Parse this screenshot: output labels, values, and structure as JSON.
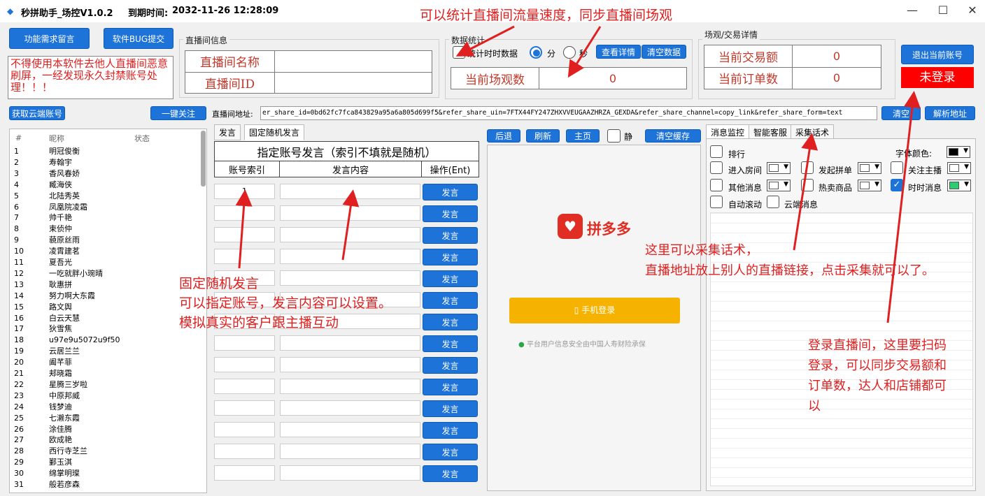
{
  "window": {
    "title": "秒拼助手_场控V1.0.2",
    "expire_label": "到期时间:",
    "expire_value": "2032-11-26 12:28:09",
    "minimize": "—",
    "maximize": "☐",
    "close": "✕"
  },
  "left_buttons": {
    "feedback": "功能需求留言",
    "bug": "软件BUG提交"
  },
  "warning_note": "不得使用本软件去他人直播间恶意刷屏，一经发现永久封禁账号处理！！！",
  "live_info": {
    "group_label": "直播间信息",
    "name_label": "直播间名称",
    "id_label": "直播间ID",
    "name_value": "",
    "id_value": ""
  },
  "stats": {
    "group_label": "数据统计",
    "realtime_checkbox": "统计时时数据",
    "unit_minute": "分",
    "unit_second": "秒",
    "detail_button": "查看详情",
    "clear_button": "清空数据",
    "viewers_label": "当前场观数",
    "viewers_value": "0"
  },
  "transaction": {
    "group_label": "场观/交易详情",
    "amount_label": "当前交易额",
    "amount_value": "0",
    "orders_label": "当前订单数",
    "orders_value": "0"
  },
  "account": {
    "logout_button": "退出当前账号",
    "status": "未登录"
  },
  "toolbar": {
    "cloud_button": "获取云端账号",
    "follow_button": "一键关注",
    "url_label": "直播间地址:",
    "url_value": "er_share_id=0bd62fc7fca843829a95a6a805d699f5&refer_share_uin=7FTX44FY247ZHXVVEUGAAZHRZA_GEXDA&refer_share_channel=copy_link&refer_share_form=text",
    "clear_button": "清空",
    "parse_button": "解析地址"
  },
  "account_list": {
    "col_num": "#",
    "col_name": "昵称",
    "col_status": "状态",
    "rows": [
      {
        "n": "1",
        "name": "明冠俊衡"
      },
      {
        "n": "2",
        "name": "寿翰宇"
      },
      {
        "n": "3",
        "name": "香风春娇"
      },
      {
        "n": "4",
        "name": "臧海侠"
      },
      {
        "n": "5",
        "name": "北陆秀英"
      },
      {
        "n": "6",
        "name": "凤凰院凌霜"
      },
      {
        "n": "7",
        "name": "帅千艳"
      },
      {
        "n": "8",
        "name": "束侦仲"
      },
      {
        "n": "9",
        "name": "藐原丝雨"
      },
      {
        "n": "10",
        "name": "凌霄建茗"
      },
      {
        "n": "11",
        "name": "夏吾光"
      },
      {
        "n": "12",
        "name": "一吃就胖小琬晴"
      },
      {
        "n": "13",
        "name": "耿惠拼"
      },
      {
        "n": "14",
        "name": "努力啊大东霞"
      },
      {
        "n": "15",
        "name": "路文舆"
      },
      {
        "n": "16",
        "name": "白云天慧"
      },
      {
        "n": "17",
        "name": "狄雪焦"
      },
      {
        "n": "18",
        "name": "u97e9u5072u9f50"
      },
      {
        "n": "19",
        "name": "云居兰兰"
      },
      {
        "n": "20",
        "name": "阖芊菲"
      },
      {
        "n": "21",
        "name": "郏晓霜"
      },
      {
        "n": "22",
        "name": "星腾三岁啦"
      },
      {
        "n": "23",
        "name": "中原邦威"
      },
      {
        "n": "24",
        "name": "钱梦迪"
      },
      {
        "n": "25",
        "name": "七濑东霞"
      },
      {
        "n": "26",
        "name": "涂佳腾"
      },
      {
        "n": "27",
        "name": "欧成艳"
      },
      {
        "n": "28",
        "name": "西行寺芝兰"
      },
      {
        "n": "29",
        "name": "鄞玉淇"
      },
      {
        "n": "30",
        "name": "绵掌明璨"
      },
      {
        "n": "31",
        "name": "般若彦森"
      }
    ]
  },
  "send_tabs": {
    "tab1": "发言",
    "tab2": "固定随机发言"
  },
  "send_table": {
    "title": "指定账号发言（索引不填就是随机）",
    "col_index": "账号索引",
    "col_content": "发言内容",
    "col_action": "操作(Ent)",
    "first_index": "1",
    "send_label": "发言"
  },
  "browser": {
    "back": "后退",
    "refresh": "刷新",
    "home": "主页",
    "mute": "静",
    "clear_cache": "清空缓存",
    "brand": "拼多多",
    "phone_login": "手机登录",
    "security_note": "平台用户信息安全由中国人寿财险承保"
  },
  "monitor": {
    "tab1": "消息监控",
    "tab2": "智能客服",
    "tab3": "采集话术",
    "rank": "排行",
    "font_color": "字体颜色:",
    "enter_room": "进入房间",
    "start_group": "发起拼单",
    "follow_host": "关注主播",
    "other_msg": "其他消息",
    "hot_goods": "热卖商品",
    "realtime_msg": "时时消息",
    "auto_scroll": "自动滚动",
    "cloud_msg": "云端消息"
  },
  "colors": {
    "accent": "#1e73d8",
    "annotation": "#e02020",
    "brand_red": "#e02e24",
    "login_yellow": "#f5b300"
  },
  "annotations": {
    "top": "可以统计直播间流量速度，同步直播间场观",
    "middle_1": "固定随机发言",
    "middle_2": "可以指定账号，发言内容可以设置。",
    "middle_3": "模拟真实的客户跟主播互动",
    "collect_1": "这里可以采集话术，",
    "collect_2": "直播地址放上别人的直播链接，点击采集就可以了。",
    "login_1": "登录直播间，这里要扫码",
    "login_2": "登录，可以同步交易额和",
    "login_3": "订单数，达人和店铺都可",
    "login_4": "以"
  }
}
